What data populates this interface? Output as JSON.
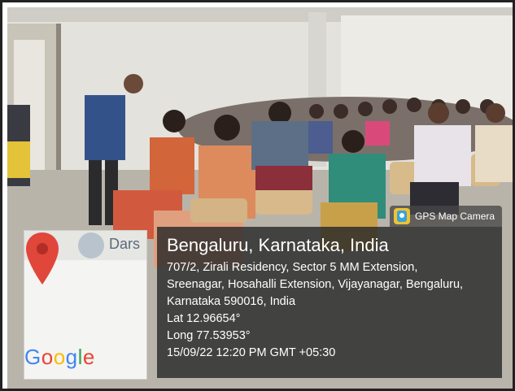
{
  "photo": {
    "description_icon": "classroom-photo"
  },
  "map": {
    "label": "Dars",
    "logo_letters": [
      "G",
      "o",
      "o",
      "g",
      "l",
      "e"
    ],
    "pin_icon": "map-pin-icon"
  },
  "badge": {
    "text": "GPS Map Camera",
    "icon": "camera-icon"
  },
  "location": {
    "title": "Bengaluru, Karnataka, India",
    "address_line1": "707/2, Zirali Residency, Sector 5 MM Extension,",
    "address_line2": "Sreenagar, Hosahalli Extension, Vijayanagar, Bengaluru,",
    "address_line3": "Karnataka 590016, India",
    "lat": "Lat 12.96654°",
    "long": "Long 77.53953°",
    "timestamp": "15/09/22 12:20 PM GMT +05:30"
  },
  "colors": {
    "panel_bg": "#282828",
    "pin": "#e0463a",
    "google_blue": "#4285F4",
    "google_red": "#EA4335",
    "google_yellow": "#FBBC05",
    "google_green": "#34A853"
  }
}
